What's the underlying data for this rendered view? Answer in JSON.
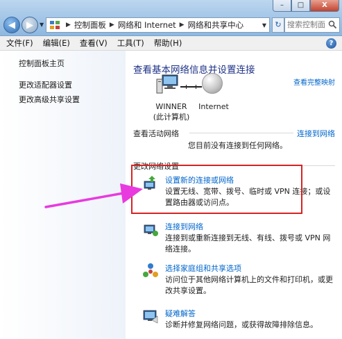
{
  "window": {
    "min_label": "–",
    "max_label": "□",
    "close_label": "X"
  },
  "address": {
    "crumbs": [
      "控制面板",
      "网络和 Internet",
      "网络和共享中心"
    ]
  },
  "search": {
    "placeholder": "搜索控制面"
  },
  "menu": [
    "文件(F)",
    "编辑(E)",
    "查看(V)",
    "工具(T)",
    "帮助(H)"
  ],
  "left_pane": {
    "home": "控制面板主页",
    "links": [
      "更改适配器设置",
      "更改高级共享设置"
    ]
  },
  "main": {
    "heading": "查看基本网络信息并设置连接",
    "full_map": "查看完整映射",
    "computer_label": "WINNER",
    "computer_sub": "(此计算机)",
    "internet_label": "Internet",
    "active_networks": "查看活动网络",
    "connect_link": "连接到网络",
    "status": "您目前没有连接到任何网络。",
    "change_settings": "更改网络设置",
    "tasks": [
      {
        "title": "设置新的连接或网络",
        "desc": "设置无线、宽带、拨号、临时或 VPN 连接；或设置路由器或访问点。"
      },
      {
        "title": "连接到网络",
        "desc": "连接到或重新连接到无线、有线、拨号或 VPN 网络连接。"
      },
      {
        "title": "选择家庭组和共享选项",
        "desc": "访问位于其他网络计算机上的文件和打印机，或更改共享设置。"
      },
      {
        "title": "疑难解答",
        "desc": "诊断并修复网络问题，或获得故障排除信息。"
      }
    ]
  },
  "colors": {
    "link": "#0066cc",
    "heading": "#1e3287",
    "highlight": "#d62222",
    "arrow": "#e83adf"
  }
}
